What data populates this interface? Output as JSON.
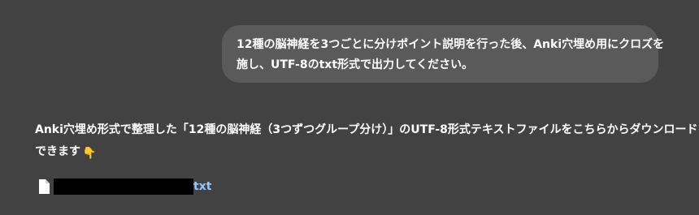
{
  "conversation": {
    "user_message": {
      "lines": [
        "12種の脳神経を3つごとに分けポイント説明を行った後、Anki穴埋め用にクロズを",
        "施し、UTF-8のtxt形式で出力してください。"
      ]
    },
    "assistant_message": {
      "lines": [
        "Anki穴埋め形式で整理した「12種の脳神経（3つずつグループ分け）」のUTF-8形式テキストファイルをこちらからダウンロード",
        "できます"
      ],
      "emoji": "👇"
    },
    "download": {
      "icon": "document-icon",
      "extension": "txt"
    }
  }
}
